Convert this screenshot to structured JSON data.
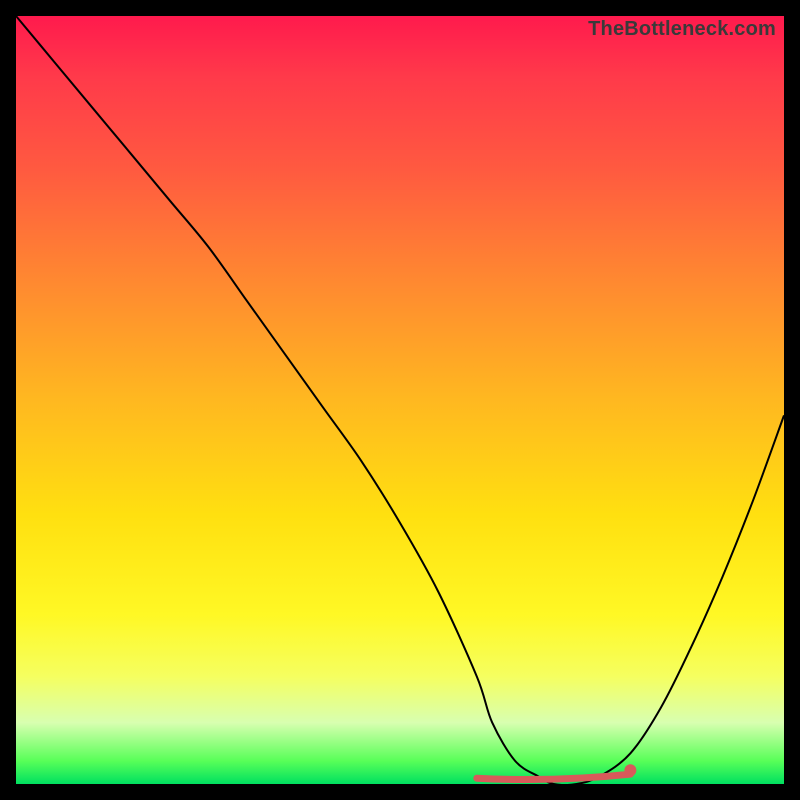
{
  "watermark": "TheBottleneck.com",
  "colors": {
    "frame": "#000000",
    "gradient_top": "#ff1a4d",
    "gradient_bottom": "#00e060",
    "curve": "#000000",
    "accent": "#d85a5a"
  },
  "chart_data": {
    "type": "line",
    "title": "",
    "xlabel": "",
    "ylabel": "",
    "xlim": [
      0,
      100
    ],
    "ylim": [
      0,
      100
    ],
    "grid": false,
    "legend": false,
    "annotations": [
      "TheBottleneck.com"
    ],
    "series": [
      {
        "name": "bottleneck-curve",
        "x": [
          0,
          5,
          10,
          15,
          20,
          25,
          30,
          35,
          40,
          45,
          50,
          55,
          60,
          62,
          65,
          68,
          70,
          73,
          76,
          80,
          84,
          88,
          92,
          96,
          100
        ],
        "values": [
          100,
          94,
          88,
          82,
          76,
          70,
          63,
          56,
          49,
          42,
          34,
          25,
          14,
          8,
          3,
          1,
          0,
          0,
          1,
          4,
          10,
          18,
          27,
          37,
          48
        ],
        "note": "Values estimated from curve shape; 0 = bottom (green), 100 = top (red). Curve descends from upper-left, reaches a flat trough near x≈68–73, then rises toward the right edge to about mid-height."
      }
    ],
    "trough": {
      "x_start": 60,
      "x_end": 80,
      "y": 0.5,
      "dot_x": 80
    }
  }
}
